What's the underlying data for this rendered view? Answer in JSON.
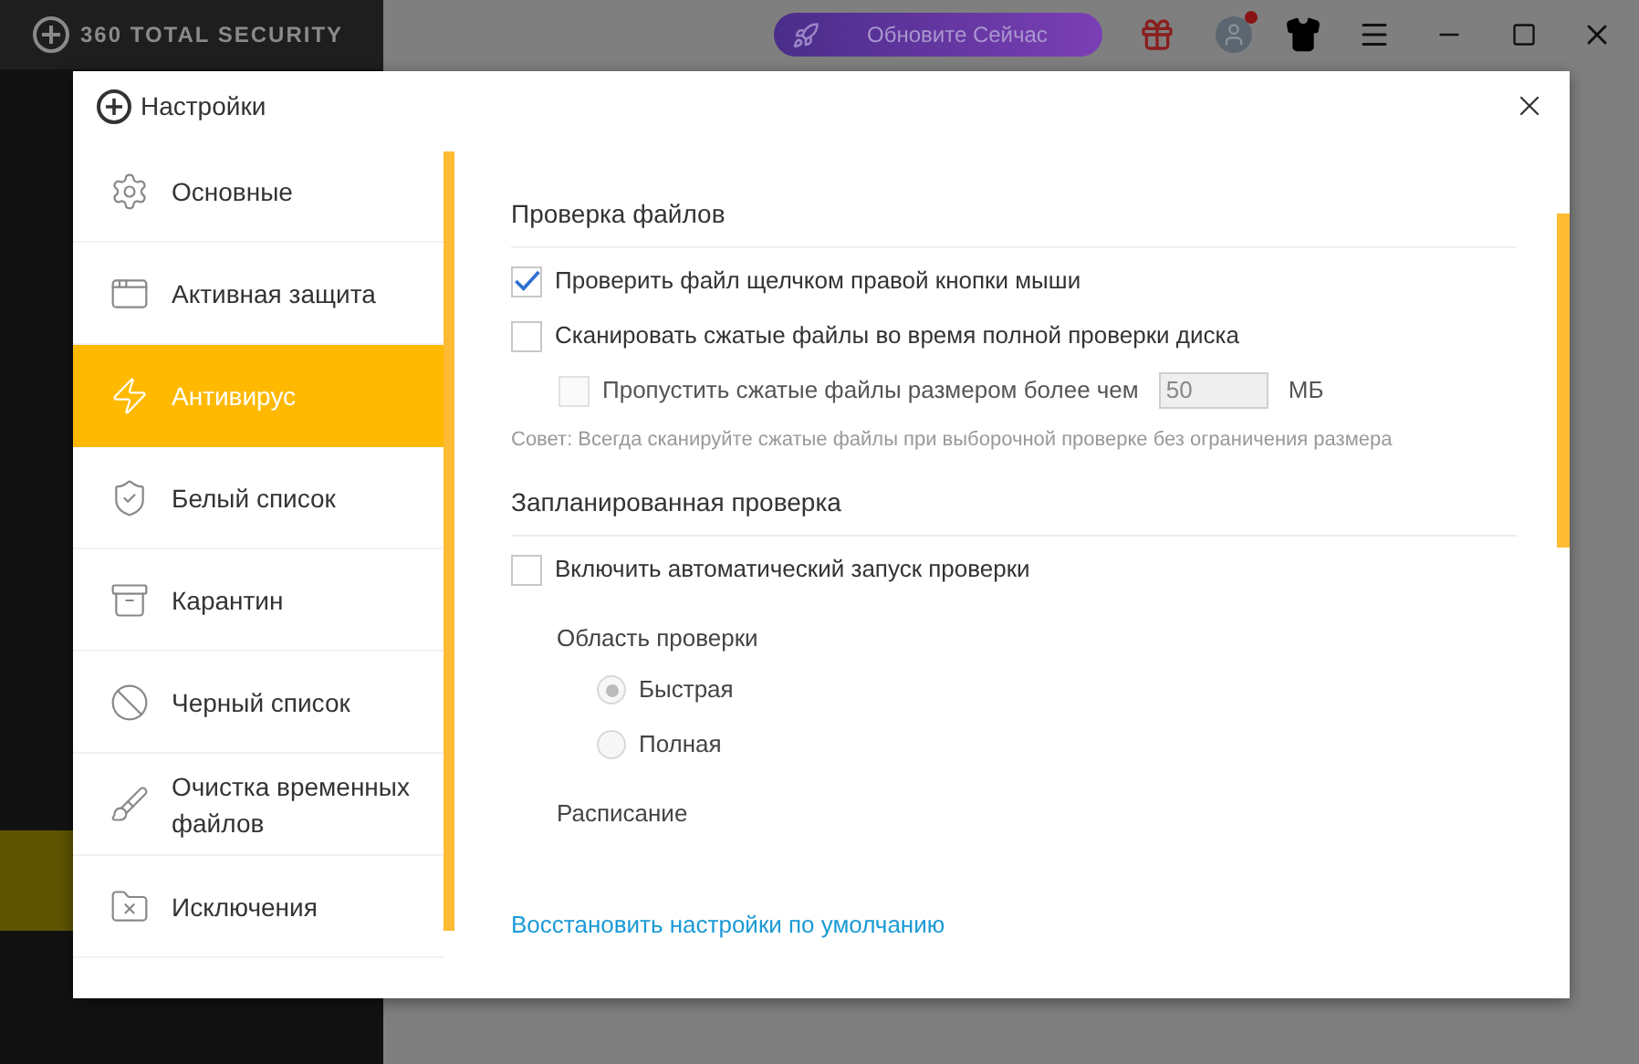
{
  "app": {
    "title": "360 TOTAL SECURITY",
    "upgrade_button": "Обновите Сейчас"
  },
  "dialog": {
    "title": "Настройки",
    "sidebar": {
      "items": [
        {
          "label": "Основные",
          "selected": false
        },
        {
          "label": "Активная защита",
          "selected": false
        },
        {
          "label": "Антивирус",
          "selected": true
        },
        {
          "label": "Белый список",
          "selected": false
        },
        {
          "label": "Карантин",
          "selected": false
        },
        {
          "label": "Черный список",
          "selected": false
        },
        {
          "label": "Очистка временных файлов",
          "selected": false
        },
        {
          "label": "Исключения",
          "selected": false
        }
      ]
    },
    "sections": [
      {
        "title": "Проверка файлов",
        "options": [
          {
            "label": "Проверить файл щелчком правой кнопки мыши",
            "checked": true
          },
          {
            "label": "Сканировать сжатые файлы во время полной проверки диска",
            "checked": false,
            "children": [
              {
                "label": "Пропустить сжатые файлы размером более чем",
                "checked": false,
                "disabled": true,
                "field": {
                  "value": "50",
                  "unit": "МБ"
                }
              }
            ]
          }
        ],
        "hint": "Совет: Всегда сканируйте сжатые файлы при выборочной проверке без ограничения размера"
      },
      {
        "title": "Запланированная проверка",
        "options": [
          {
            "label": "Включить автоматический запуск проверки",
            "checked": false
          }
        ],
        "groups": [
          {
            "title": "Область проверки",
            "radios": [
              {
                "label": "Быстрая",
                "selected": true,
                "disabled": true
              },
              {
                "label": "Полная",
                "selected": false,
                "disabled": true
              }
            ]
          },
          {
            "title": "Расписание"
          }
        ]
      }
    ],
    "reset_link": "Восстановить настройки по умолчанию"
  }
}
